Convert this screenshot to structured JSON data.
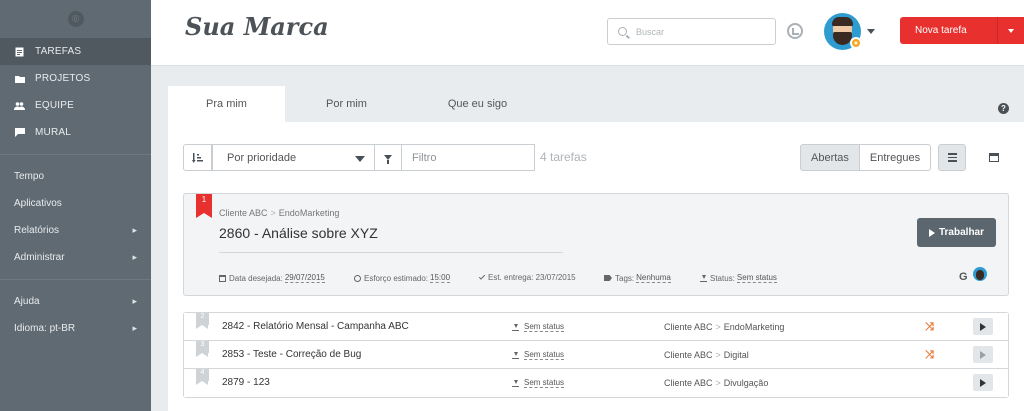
{
  "colors": {
    "accent": "#e8312e",
    "sidebar": "#5f6a72",
    "work_button": "#5b666e"
  },
  "sidebar": {
    "logo_icon": "logo-circle-icon",
    "primary": [
      {
        "label": "TAREFAS",
        "icon": "document-icon"
      },
      {
        "label": "PROJETOS",
        "icon": "folder-icon"
      },
      {
        "label": "EQUIPE",
        "icon": "users-icon"
      },
      {
        "label": "MURAL",
        "icon": "chat-icon"
      }
    ],
    "secondary": [
      {
        "label": "Tempo"
      },
      {
        "label": "Aplicativos"
      },
      {
        "label": "Relatórios"
      },
      {
        "label": "Administrar"
      }
    ],
    "footer": [
      {
        "label": "Ajuda"
      },
      {
        "label": "Idioma: pt-BR"
      }
    ]
  },
  "header": {
    "brand": "Sua Marca",
    "search_placeholder": "Buscar",
    "new_task_label": "Nova tarefa"
  },
  "tabs": [
    {
      "label": "Pra mim"
    },
    {
      "label": "Por mim"
    },
    {
      "label": "Que eu sigo"
    }
  ],
  "toolbar": {
    "sort_value": "Por prioridade",
    "filter_placeholder": "Filtro",
    "count": "4 tarefas",
    "open_label": "Abertas",
    "delivered_label": "Entregues"
  },
  "featured": {
    "rank": "1",
    "client": "Cliente ABC",
    "project": "EndoMarketing",
    "separator": ">",
    "title": "2860 - Análise sobre XYZ",
    "work_label": "Trabalhar",
    "desired_date_label": "Data desejada:",
    "desired_date": "29/07/2015",
    "effort_label": "Esforço estimado:",
    "effort": "15:00",
    "delivery_label": "Est. entrega:",
    "delivery": "23/07/2015",
    "tags_label": "Tags:",
    "tags": "Nenhuma",
    "status_label": "Status:",
    "status": "Sem status",
    "g_label": "G"
  },
  "tasks": [
    {
      "rank": "2",
      "title": "2842 - Relatório Mensal - Campanha ABC",
      "status": "Sem status",
      "client": "Cliente ABC",
      "separator": ">",
      "project": "EndoMarketing"
    },
    {
      "rank": "3",
      "title": "2853 - Teste - Correção de Bug",
      "status": "Sem status",
      "client": "Cliente ABC",
      "separator": ">",
      "project": "Digital"
    },
    {
      "rank": "4",
      "title": "2879 - 123",
      "status": "Sem status",
      "client": "Cliente ABC",
      "separator": ">",
      "project": "Divulgação"
    }
  ]
}
